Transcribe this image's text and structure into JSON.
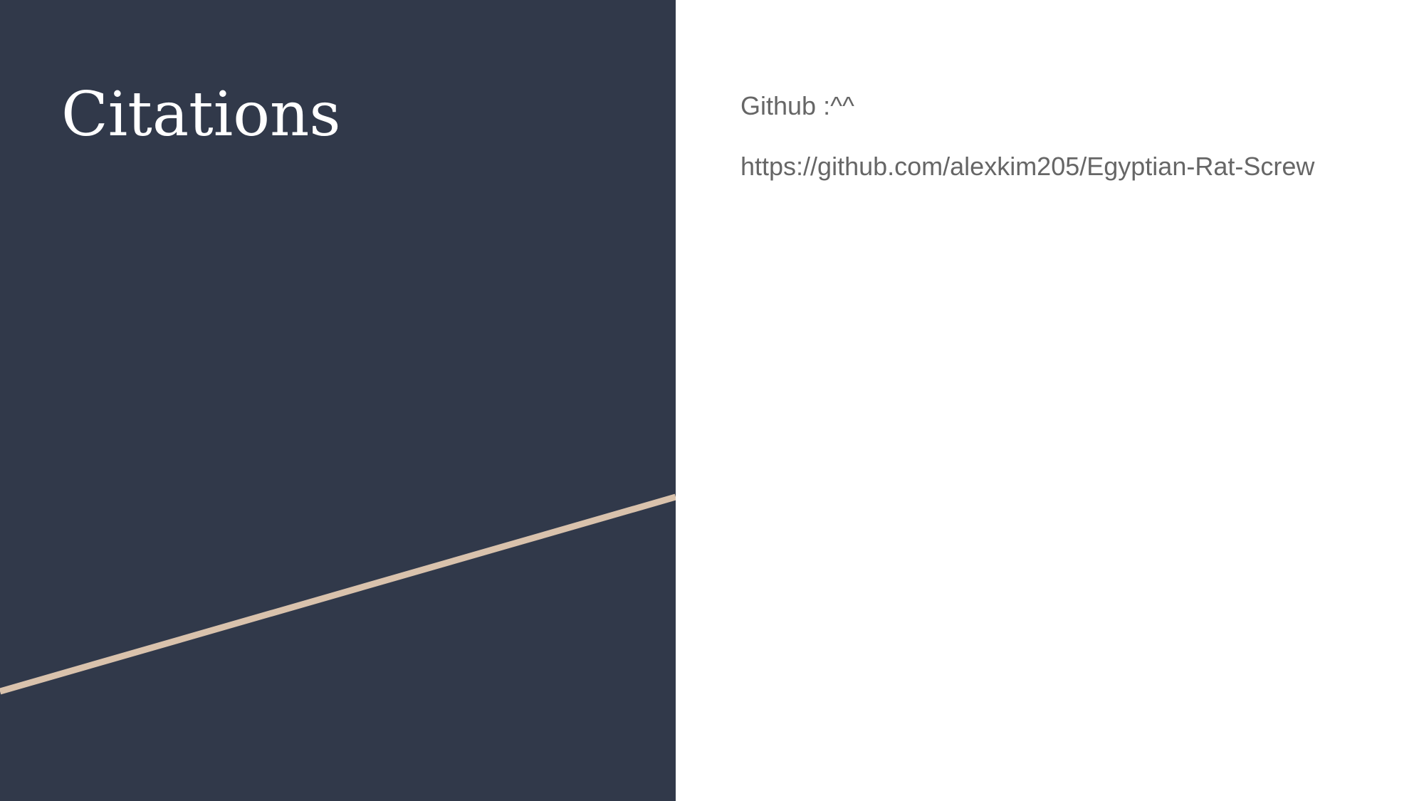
{
  "slide": {
    "title": "Citations",
    "lines": [
      "Github :^^",
      "https://github.com/alexkim205/Egyptian-Rat-Screw"
    ],
    "colors": {
      "panel": "#31394a",
      "accent_line": "#d9c2ac",
      "text": "#666666"
    }
  }
}
